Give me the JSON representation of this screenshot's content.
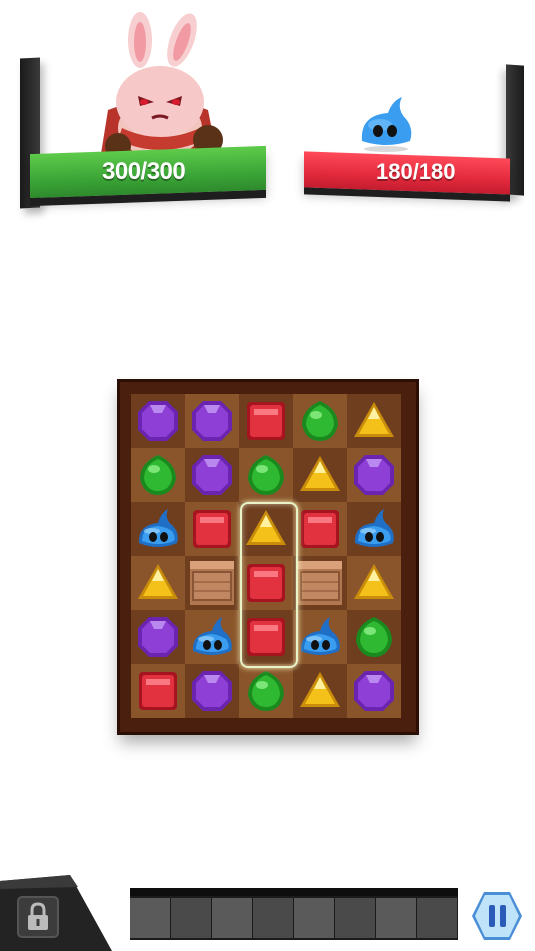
{
  "player": {
    "hp_current": "300",
    "hp_max": "300",
    "hp_text": "300/300",
    "character": "rabbit-warrior"
  },
  "enemy": {
    "hp_current": "180",
    "hp_max": "180",
    "hp_text": "180/180",
    "character": "blue-slime"
  },
  "colors": {
    "player_bar": "#3ba637",
    "enemy_bar": "#e22a3c",
    "board_frame": "#4a1f0e",
    "gem_purple": "#8d3fd6",
    "gem_green": "#2fb832",
    "gem_red": "#e2313f",
    "gem_yellow": "#f3c11a",
    "slime_blue": "#3a9df0",
    "pause_button": "#9fd3f2"
  },
  "board": {
    "rows": [
      [
        "purple",
        "purple",
        "red",
        "green",
        "yellow"
      ],
      [
        "green",
        "purple",
        "green",
        "yellow",
        "purple"
      ],
      [
        "slime",
        "red",
        "yellow",
        "red",
        "slime"
      ],
      [
        "yellow",
        "crate",
        "red",
        "crate",
        "yellow"
      ],
      [
        "purple",
        "slime",
        "red",
        "slime",
        "green"
      ],
      [
        "red",
        "purple",
        "green",
        "yellow",
        "purple"
      ]
    ]
  },
  "bottom": {
    "lock_icon": "lock-icon",
    "pause_icon": "pause-icon",
    "skill_slots": 8
  }
}
